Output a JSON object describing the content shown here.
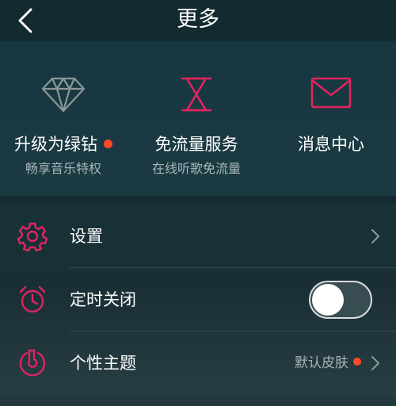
{
  "header": {
    "title": "更多",
    "back_icon": "chevron-left-icon"
  },
  "quick_actions": [
    {
      "label": "升级为绿钻",
      "sub": "畅享音乐特权",
      "icon": "diamond-icon",
      "has_dot": true
    },
    {
      "label": "免流量服务",
      "sub": "在线听歌免流量",
      "icon": "hourglass-icon",
      "has_dot": false
    },
    {
      "label": "消息中心",
      "sub": "",
      "icon": "envelope-icon",
      "has_dot": false
    }
  ],
  "settings": [
    {
      "label": "设置",
      "icon": "gear-icon",
      "control": "chevron"
    },
    {
      "label": "定时关闭",
      "icon": "alarm-clock-icon",
      "control": "toggle",
      "toggle_on": false
    },
    {
      "label": "个性主题",
      "icon": "theme-icon",
      "control": "value",
      "value": "默认皮肤",
      "has_dot": true
    }
  ],
  "colors": {
    "accent": "#e0245e",
    "notification_dot": "#ff4a2a",
    "diamond_icon": "#8a9799",
    "background": "#163339"
  }
}
